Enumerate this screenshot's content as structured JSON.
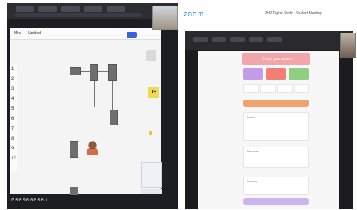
{
  "zoom": {
    "logo": "zoom",
    "meeting_title": "PHP Digital Study - Student Meeting"
  },
  "left_share": {
    "toolbar": {
      "labels": [
        "Miro",
        "Untitled"
      ]
    },
    "sidebar_numbers": [
      "1",
      "2",
      "3",
      "4",
      "5",
      "6",
      "7",
      "8",
      "9",
      "10"
    ],
    "badge": "JS",
    "bottom_digits": "0000000001"
  },
  "right_share": {
    "hero_label": "Create your project",
    "tiles": [
      {
        "color": "#c49be6"
      },
      {
        "color": "#f47d76"
      },
      {
        "color": "#8ed07f"
      },
      {
        "color": "#f4a94b"
      }
    ],
    "cards": [
      {
        "label": "Details"
      },
      {
        "label": "Resources"
      },
      {
        "label": "Summary"
      }
    ]
  }
}
